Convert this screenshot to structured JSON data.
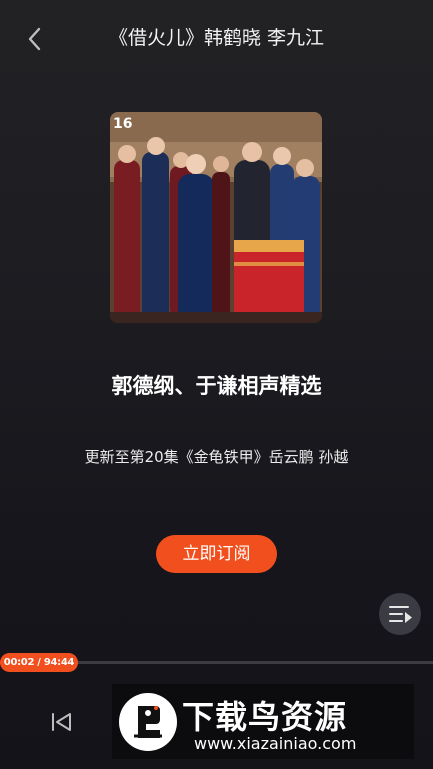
{
  "header": {
    "back_icon": "chevron-left-icon",
    "title": "《借火儿》韩鹤晓 李九江"
  },
  "album": {
    "cover_image": "group-photo-performers",
    "name": "郭德纲、于谦相声精选",
    "update_text": "更新至第20集《金龟铁甲》岳云鹏 孙越",
    "subscribe_label": "立即订阅",
    "cover_corner_text": "16"
  },
  "player": {
    "time_display": "00:02 / 94:44",
    "progress_fraction": 0.18,
    "playlist_icon": "playlist-icon",
    "prev_icon": "skip-previous-icon"
  },
  "watermark": {
    "title": "下载鸟资源",
    "url": "www.xiazainiao.com"
  },
  "colors": {
    "accent": "#f1501e",
    "background": "#1c1c21"
  }
}
